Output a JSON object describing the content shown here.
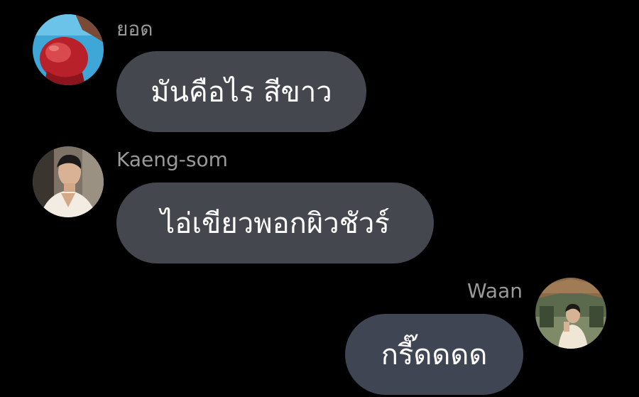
{
  "messages": [
    {
      "sender": "ยอด",
      "text": "มันคือไร สีขาว",
      "avatar_icon": "boxing-glove-avatar",
      "side": "left"
    },
    {
      "sender": "Kaeng-som",
      "text": "ไอ่เขียวพอกผิวชัวร์",
      "avatar_icon": "person-portrait-avatar",
      "side": "left"
    },
    {
      "sender": "Waan",
      "text": "กรี๊ดดดด",
      "avatar_icon": "person-outdoor-avatar",
      "side": "right"
    }
  ],
  "colors": {
    "background": "#000000",
    "bubble": "#44474e",
    "bubble_own": "#3f4553",
    "sender_text": "#9a9a9a",
    "message_text": "#ffffff"
  }
}
